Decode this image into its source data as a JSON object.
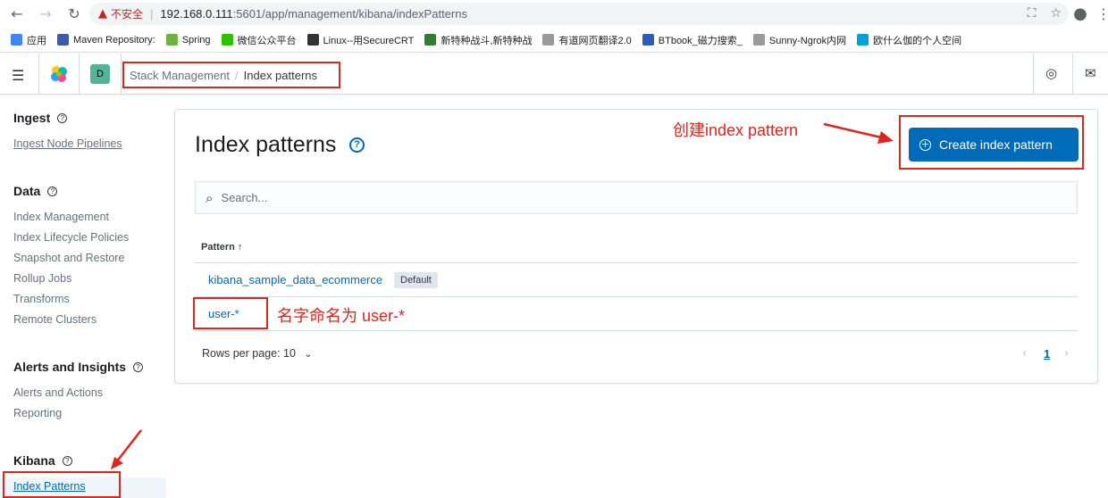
{
  "browser": {
    "insecure_label": "不安全",
    "url_host": "192.168.0.111",
    "url_rest": ":5601/app/management/kibana/indexPatterns",
    "bookmarks": [
      {
        "label": "应用",
        "icon": "apps-grid-icon",
        "color": "#4285f4"
      },
      {
        "label": "Maven Repository:",
        "icon": "mvn-icon",
        "color": "#3c5aa6"
      },
      {
        "label": "Spring",
        "icon": "spring-icon",
        "color": "#6db33f"
      },
      {
        "label": "微信公众平台",
        "icon": "wechat-icon",
        "color": "#2dc100"
      },
      {
        "label": "Linux--用SecureCRT",
        "icon": "linux-icon",
        "color": "#333333"
      },
      {
        "label": "新特种战斗,新特种战",
        "icon": "grid-icon",
        "color": "#2e7d32"
      },
      {
        "label": "有道网页翻译2.0",
        "icon": "page-icon",
        "color": "#999999"
      },
      {
        "label": "BTbook_磁力搜索_",
        "icon": "b-icon",
        "color": "#2f5bb7"
      },
      {
        "label": "Sunny-Ngrok内网",
        "icon": "page-icon",
        "color": "#999999"
      },
      {
        "label": "欧什么伽的个人空间",
        "icon": "bilibili-icon",
        "color": "#00a1d6"
      }
    ]
  },
  "header": {
    "space_initial": "D",
    "breadcrumb_1": "Stack Management",
    "breadcrumb_2": "Index patterns"
  },
  "sidebar": {
    "ingest": {
      "title": "Ingest",
      "items": [
        "Ingest Node Pipelines"
      ]
    },
    "data": {
      "title": "Data",
      "items": [
        "Index Management",
        "Index Lifecycle Policies",
        "Snapshot and Restore",
        "Rollup Jobs",
        "Transforms",
        "Remote Clusters"
      ]
    },
    "alerts": {
      "title": "Alerts and Insights",
      "items": [
        "Alerts and Actions",
        "Reporting"
      ]
    },
    "kibana": {
      "title": "Kibana",
      "items": [
        "Index Patterns"
      ]
    }
  },
  "main": {
    "title": "Index patterns",
    "create_button": "Create index pattern",
    "search_placeholder": "Search...",
    "column_header": "Pattern ↑",
    "rows": [
      {
        "pattern": "kibana_sample_data_ecommerce",
        "badge": "Default"
      },
      {
        "pattern": "user-*"
      }
    ],
    "rows_per_page": "Rows per page: 10",
    "current_page": "1"
  },
  "annotations": {
    "create": "创建index pattern",
    "name": "名字命名为 user-*"
  },
  "colors": {
    "accent": "#006bb8",
    "annotation": "#e0251b"
  }
}
